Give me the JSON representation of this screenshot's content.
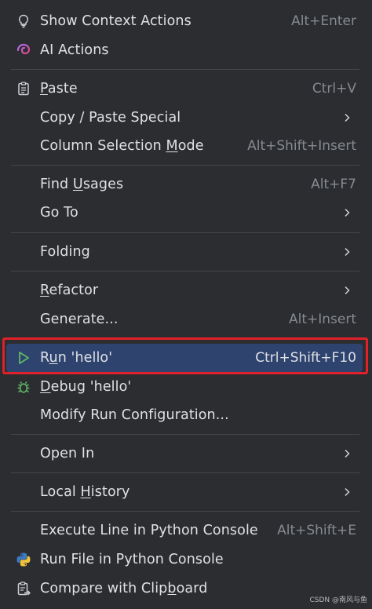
{
  "menu": {
    "show_context_actions": {
      "label": "Show Context Actions",
      "shortcut": "Alt+Enter",
      "icon": "lightbulb-icon"
    },
    "ai_actions": {
      "label": "AI Actions",
      "icon": "ai-spiral-icon"
    },
    "paste": {
      "pre": "",
      "mn": "P",
      "post": "aste",
      "shortcut": "Ctrl+V",
      "icon": "clipboard-icon"
    },
    "copy_paste_special": {
      "label": "Copy / Paste Special"
    },
    "column_selection_mode": {
      "pre": "Column Selection ",
      "mn": "M",
      "post": "ode",
      "shortcut": "Alt+Shift+Insert"
    },
    "find_usages": {
      "pre": "Find ",
      "mn": "U",
      "post": "sages",
      "shortcut": "Alt+F7"
    },
    "go_to": {
      "label": "Go To"
    },
    "folding": {
      "label": "Folding"
    },
    "refactor": {
      "pre": "",
      "mn": "R",
      "post": "efactor"
    },
    "generate": {
      "label": "Generate...",
      "shortcut": "Alt+Insert"
    },
    "run": {
      "pre": "R",
      "mn": "u",
      "post": "n 'hello'",
      "shortcut": "Ctrl+Shift+F10",
      "icon": "run-triangle-icon"
    },
    "debug": {
      "pre": "",
      "mn": "D",
      "post": "ebug 'hello'",
      "icon": "bug-icon"
    },
    "modify_run_configuration": {
      "label": "Modify Run Configuration..."
    },
    "open_in": {
      "label": "Open In"
    },
    "local_history": {
      "pre": "Local ",
      "mn": "H",
      "post": "istory"
    },
    "execute_line": {
      "label": "Execute Line in Python Console",
      "shortcut": "Alt+Shift+E"
    },
    "run_file": {
      "label": "Run File in Python Console",
      "icon": "python-icon"
    },
    "compare_clipboard": {
      "pre": "Compare with Clip",
      "mn": "b",
      "post": "oard",
      "icon": "compare-clipboard-icon"
    }
  },
  "colors": {
    "background": "#2b2d30",
    "selection": "#2e436e",
    "highlight_border": "#e2202a",
    "run_green": "#5fb865"
  },
  "watermark": "CSDN @南风与鱼"
}
